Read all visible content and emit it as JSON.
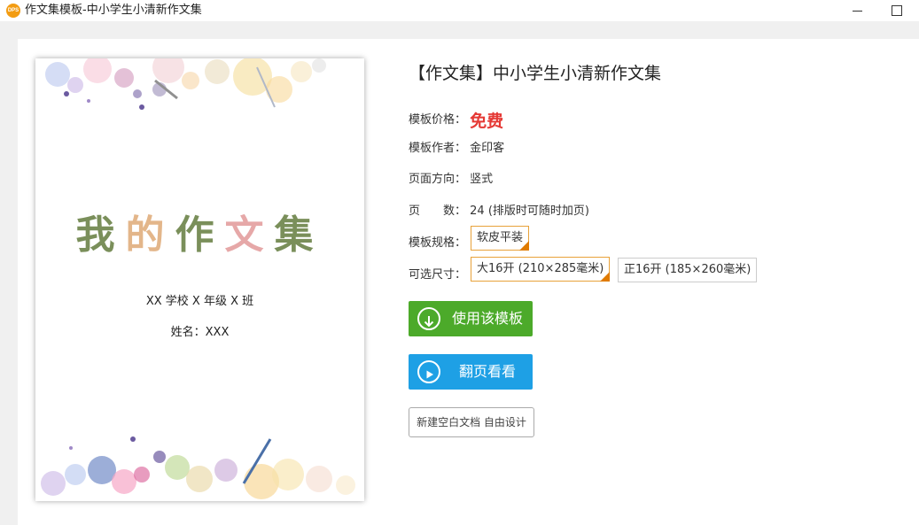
{
  "window": {
    "icon_text": "DPS",
    "title": "作文集模板-中小学生小清新作文集"
  },
  "cover": {
    "title_chars": [
      "我",
      "的",
      "作",
      "文",
      "集"
    ],
    "school": "XX 学校 X 年级 X 班",
    "name": "姓名：XXX"
  },
  "info": {
    "title": "【作文集】中小学生小清新作文集",
    "price_label": "模板价格：",
    "price_value": "免费",
    "author_label": "模板作者：",
    "author_value": "金印客",
    "direction_label": "页面方向：",
    "direction_value": "竖式",
    "pages_label_1": "页",
    "pages_label_2": "数：",
    "pages_value": "24 (排版时可随时加页)",
    "spec_label": "模板规格：",
    "spec_options": [
      "软皮平装"
    ],
    "size_label": "可选尺寸：",
    "size_options": [
      "大16开 (210×285毫米)",
      "正16开 (185×260毫米)"
    ]
  },
  "actions": {
    "use_template": "使用该模板",
    "flip_view": "翻页看看",
    "new_blank": "新建空白文档 自由设计"
  },
  "colors": {
    "price": "#e53935",
    "use_button": "#4caa2a",
    "flip_button": "#1ea0e5",
    "selected_border": "#e8a23a"
  }
}
